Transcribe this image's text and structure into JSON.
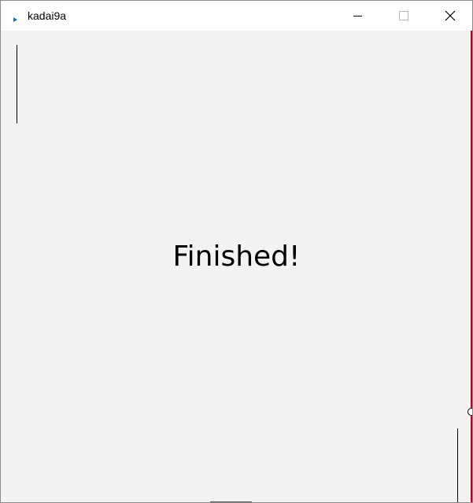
{
  "window": {
    "title": "kadai9a",
    "app_icon": "play-arrow-icon",
    "controls": {
      "minimize_icon": "minimize-icon",
      "maximize_icon": "maximize-icon",
      "close_icon": "close-icon"
    }
  },
  "canvas": {
    "background": "#f3f3f3",
    "message": "Finished!",
    "wall_color": "#c0000a",
    "accent_blue": "#0078d7"
  }
}
